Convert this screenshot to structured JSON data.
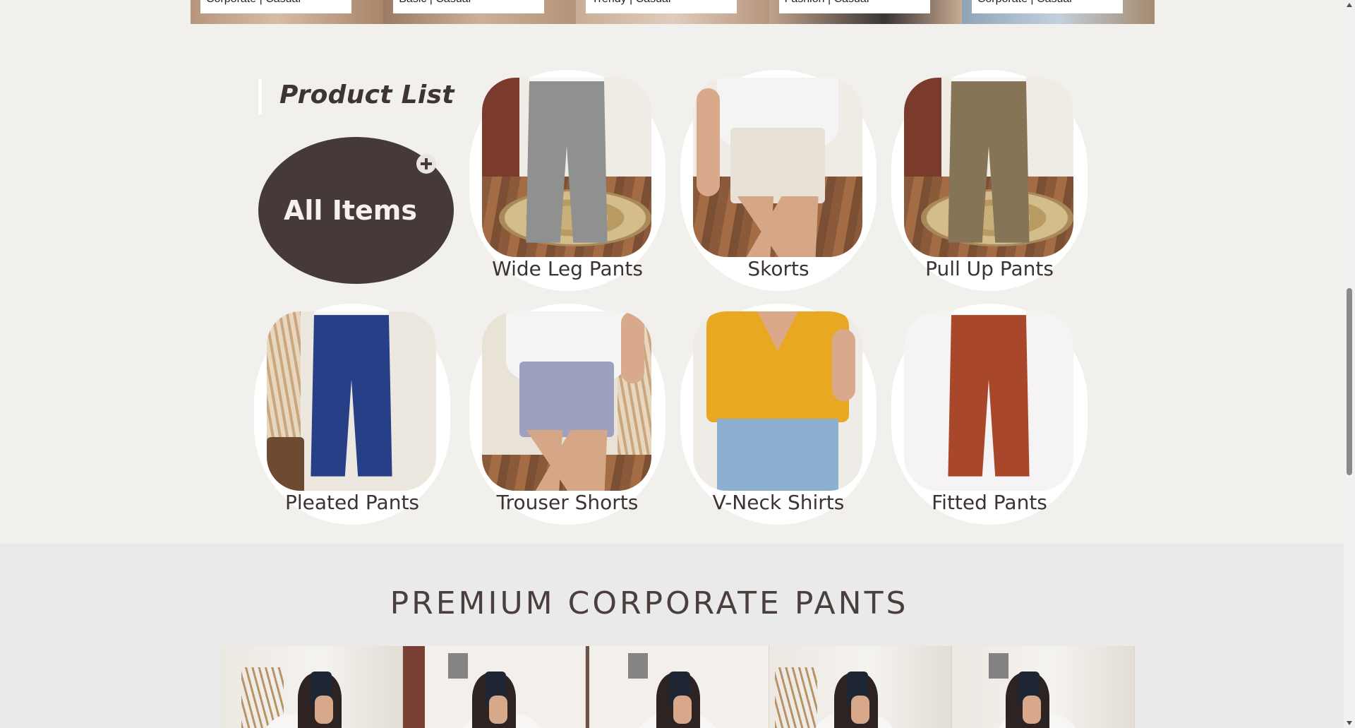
{
  "top_banner": {
    "tags": [
      "Corporate | Casual",
      "Basic | Casual",
      "Trendy | Casual",
      "Fashion | Casual",
      "Corporate | Casual"
    ]
  },
  "product_list": {
    "heading": "Product List",
    "all_items_label": "All Items",
    "cards": [
      {
        "label": "Wide Leg Pants",
        "garment_color": "#8f9090",
        "style": "pants-rug"
      },
      {
        "label": "Skorts",
        "garment_color": "#e7e1d6",
        "style": "shorts-white"
      },
      {
        "label": "Pull Up Pants",
        "garment_color": "#857456",
        "style": "pants-rug"
      },
      {
        "label": "Pleated Pants",
        "garment_color": "#263f86",
        "style": "pants-plant"
      },
      {
        "label": "Trouser Shorts",
        "garment_color": "#9da0bf",
        "style": "shorts-plant"
      },
      {
        "label": "V-Neck Shirts",
        "garment_color": "#e9a822",
        "style": "vneck"
      },
      {
        "label": "Fitted Pants",
        "garment_color": "#a9472b",
        "style": "pants-studio"
      }
    ]
  },
  "premium": {
    "title": "PREMIUM CORPORATE PANTS"
  },
  "colors": {
    "page_bg": "#f1f0ed",
    "all_items_bg": "#45393a",
    "premium_bg": "#ebeaea",
    "text_dark": "#3a3331"
  }
}
